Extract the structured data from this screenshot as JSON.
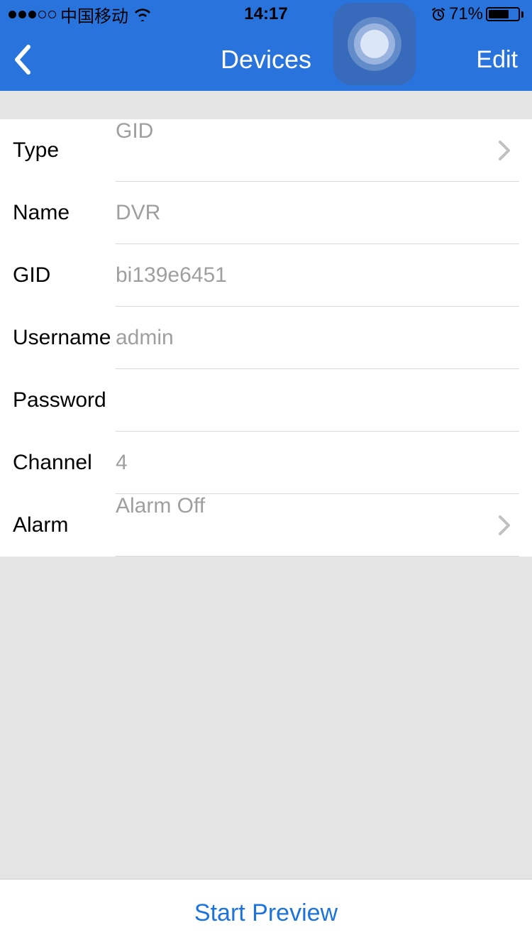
{
  "status": {
    "carrier": "中国移动",
    "time": "14:17",
    "battery_pct": "71%"
  },
  "nav": {
    "title": "Devices",
    "edit": "Edit"
  },
  "form": {
    "type": {
      "label": "Type",
      "value": "GID"
    },
    "name": {
      "label": "Name",
      "value": "DVR"
    },
    "gid": {
      "label": "GID",
      "value": "bi139e6451"
    },
    "username": {
      "label": "Username",
      "value": "admin"
    },
    "password": {
      "label": "Password",
      "value": ""
    },
    "channel": {
      "label": "Channel",
      "value": "4"
    },
    "alarm": {
      "label": "Alarm",
      "value": "Alarm Off"
    }
  },
  "footer": {
    "start_preview": "Start Preview"
  }
}
